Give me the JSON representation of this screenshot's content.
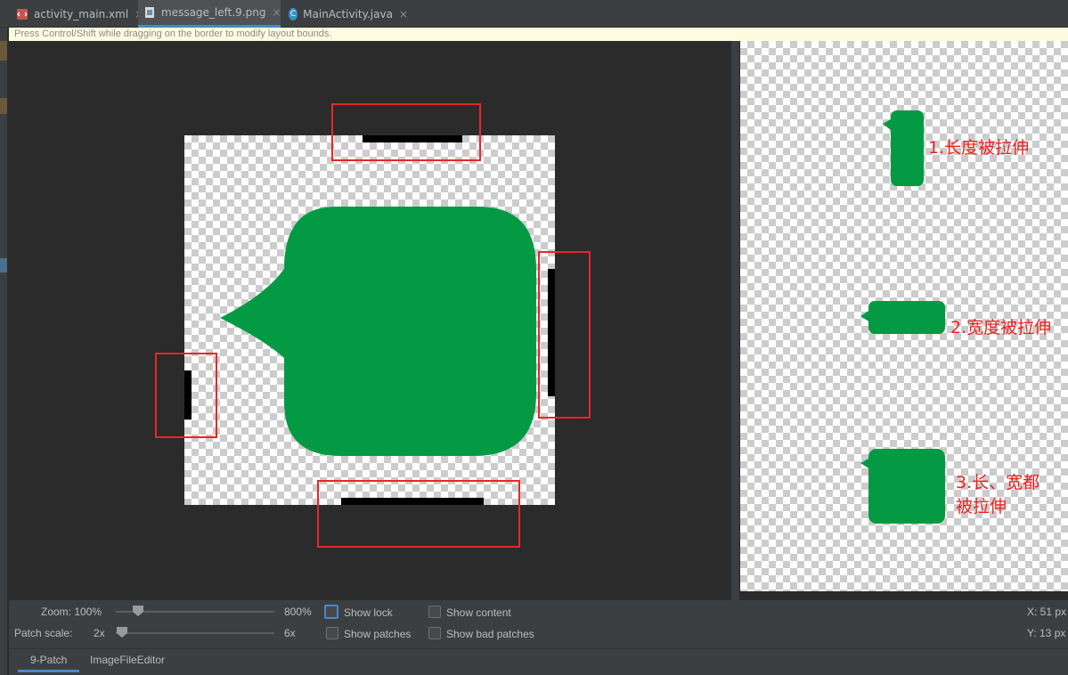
{
  "tabs": [
    {
      "label": "activity_main.xml",
      "icon": "xml-file-icon",
      "icon_color": "#c75450"
    },
    {
      "label": "message_left.9.png",
      "icon": "image-file-icon",
      "icon_color": "#6a8caf"
    },
    {
      "label": "MainActivity.java",
      "icon": "java-class-icon",
      "icon_color": "#3592c4"
    }
  ],
  "tab_close": "×",
  "class_glyph": "C",
  "hint": "Press Control/Shift while dragging on the border to modify layout bounds.",
  "bubble_color": "#039a43",
  "annotation_color": "#e8262b",
  "preview_labels": {
    "vertical": "1.长度被拉伸",
    "horizontal": "2.宽度被拉伸",
    "both_line1": "3.长、宽都",
    "both_line2": "被拉伸"
  },
  "controls": {
    "zoom_label": "Zoom: 100%",
    "zoom_max": "800%",
    "zoom_level_pct": 14,
    "patch_scale_label": "Patch scale:",
    "patch_scale_min": "2x",
    "patch_scale_max": "6x",
    "patch_scale_level_pct": 0,
    "show_lock": "Show lock",
    "show_content": "Show content",
    "show_patches": "Show patches",
    "show_bad_patches": "Show bad patches",
    "coord_x": "X: 51 px",
    "coord_y": "Y: 13 px"
  },
  "bottom_tabs": [
    "9-Patch",
    "ImageFileEditor"
  ]
}
